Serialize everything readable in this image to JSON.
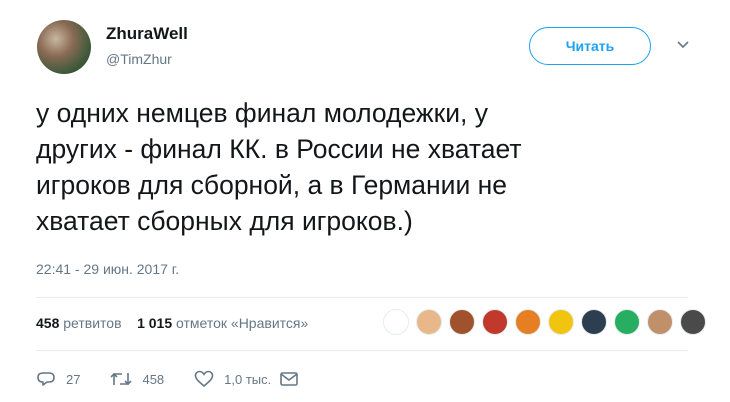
{
  "author": {
    "name": "ZhuraWell",
    "handle": "@TimZhur"
  },
  "follow_button_label": "Читать",
  "tweet": {
    "text": "у одних немцев финал молодежки, у\nдругих - финал КК. в России не хватает\nигроков для сборной, а в Германии не\nхватает сборных для игроков.)",
    "timestamp": "22:41 - 29 июн. 2017 г."
  },
  "stats": {
    "retweets_count": "458",
    "retweets_label": "ретвитов",
    "likes_count": "1 015",
    "likes_label": "отметок «Нравится»"
  },
  "liker_avatar_colors": [
    "#ffffff",
    "#e8b88a",
    "#a0522d",
    "#c0392b",
    "#e67e22",
    "#f1c40f",
    "#2c3e50",
    "#27ae60",
    "#c0906a",
    "#4a4a4a"
  ],
  "actions": {
    "reply_count": "27",
    "retweet_count": "458",
    "like_count": "1,0 тыс."
  },
  "colors": {
    "accent": "#1da1f2",
    "muted": "#657786",
    "text": "#14171a"
  }
}
